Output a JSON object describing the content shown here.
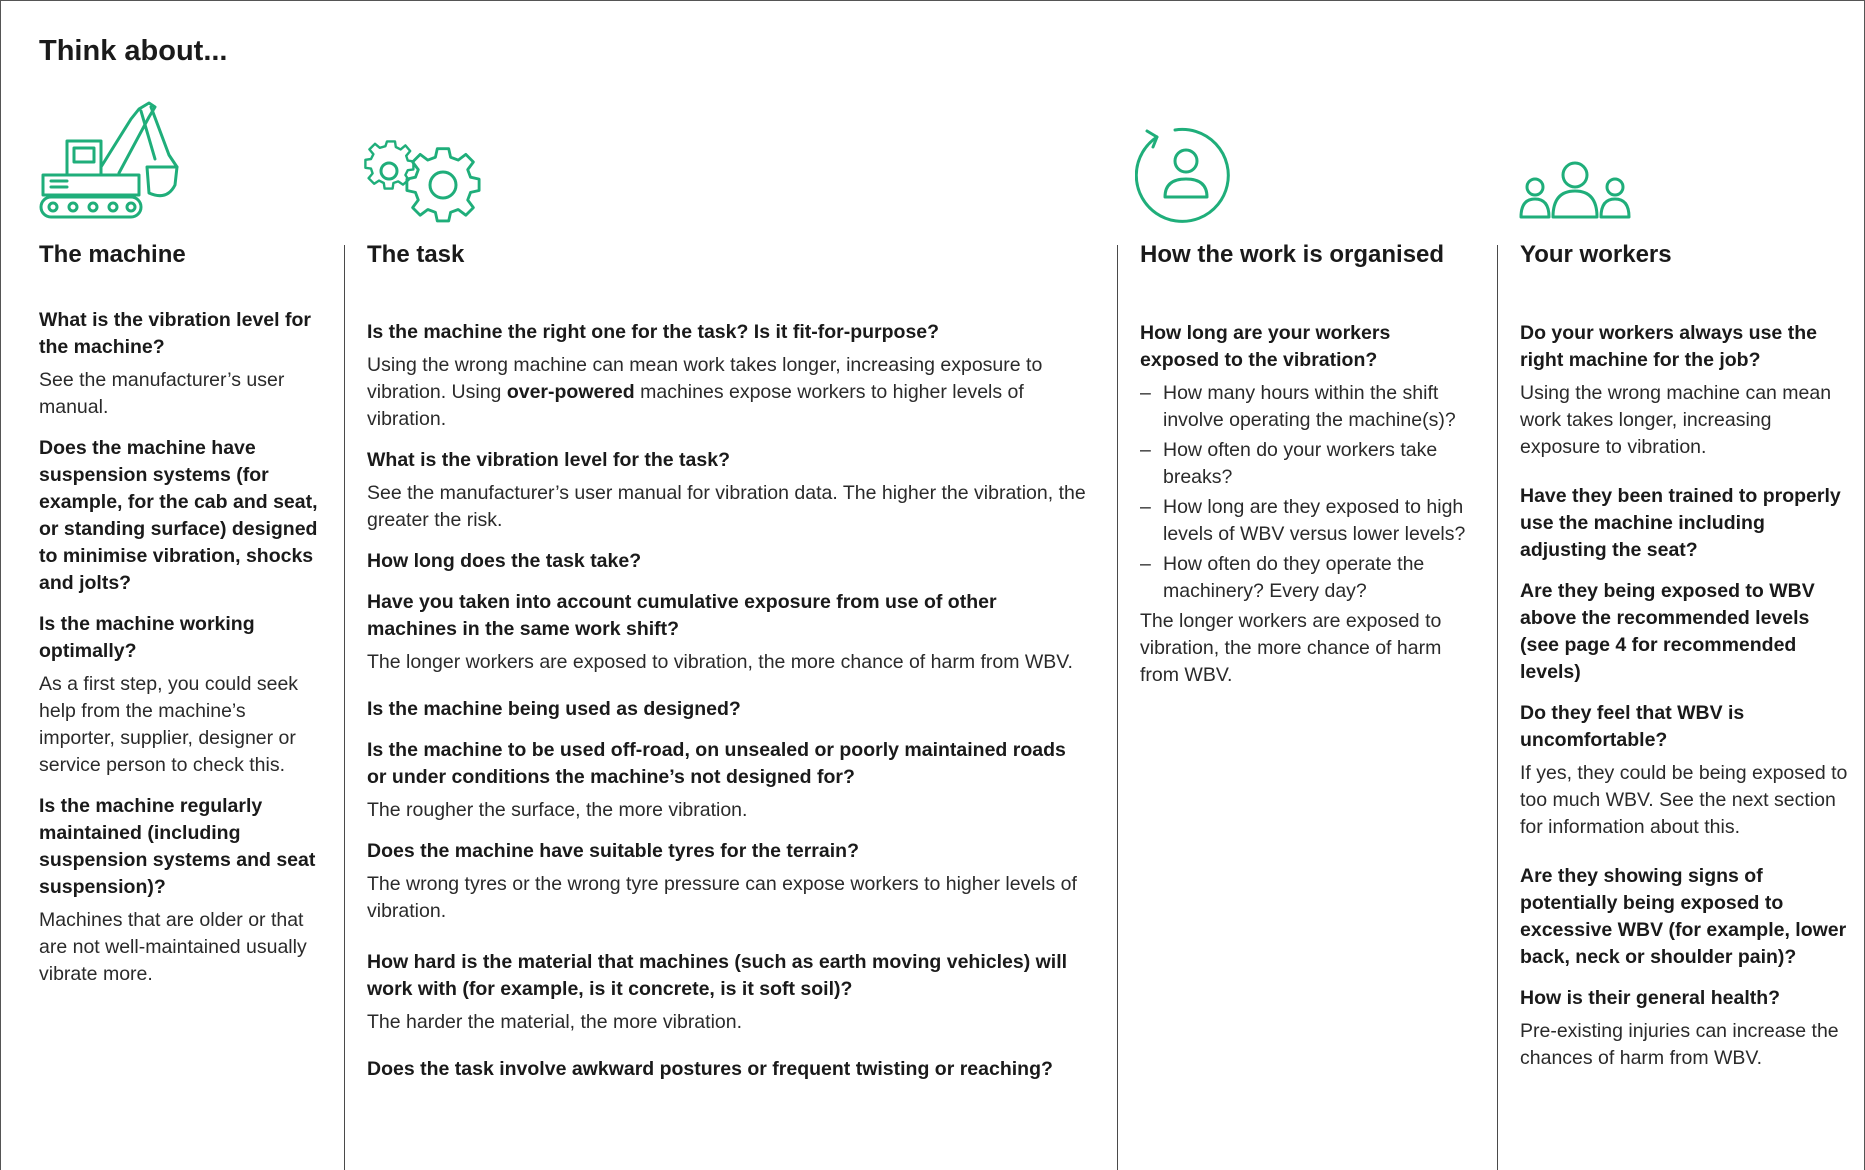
{
  "title": "Think about...",
  "accent_color": "#1fae7a",
  "icons": {
    "machine": "excavator-icon",
    "task": "gears-icon",
    "organised": "person-cycle-icon",
    "workers": "group-icon"
  },
  "machine": {
    "title": "The machine",
    "blocks": [
      {
        "q": "What is the vibration level for the machine?",
        "a": "See the manufacturer’s user manual."
      },
      {
        "q": "Does the machine have suspension systems (for example, for the cab and seat, or standing surface) designed to minimise vibration, shocks and jolts?"
      },
      {
        "q": "Is the machine working optimally?",
        "a": "As a first step, you could seek help from the machine’s importer, supplier, designer or service person to check this."
      },
      {
        "q": "Is the machine regularly maintained (including suspension systems and seat suspension)?",
        "a": "Machines that are older or that are not well-maintained usually vibrate more."
      }
    ]
  },
  "task": {
    "title": "The task",
    "b1_q": "Is the machine the right one for the task? Is it fit-for-purpose?",
    "b1_a_pre": "Using the wrong machine can mean work takes longer, increasing exposure to vibration. Using ",
    "b1_a_bold": "over-powered",
    "b1_a_post": " machines expose workers to higher levels of vibration.",
    "b2_q": "What is the vibration level for the task?",
    "b2_a": "See the manufacturer’s user manual for vibration data. The higher the vibration, the greater the risk.",
    "b3_q": "How long does the task take?",
    "b4_q": "Have you taken into account cumulative exposure from use of other machines in the same work shift?",
    "b4_a": "The longer workers are exposed to vibration, the more chance of harm from WBV.",
    "b5_q": "Is the machine being used as designed?",
    "b6_q": "Is the machine to be used off-road, on unsealed or poorly maintained roads or under conditions the machine’s not designed for?",
    "b6_a": "The rougher the surface, the more vibration.",
    "b7_q": "Does the machine have suitable tyres for the terrain?",
    "b7_a": "The wrong tyres or the wrong tyre pressure can expose workers to higher levels of vibration.",
    "b8_q": "How hard is the material that machines (such as earth moving vehicles) will work with (for example, is it concrete, is it soft soil)?",
    "b8_a": "The harder the material, the more vibration.",
    "b9_q": "Does the task involve awkward postures or frequent twisting or reaching?"
  },
  "organised": {
    "title": "How the work is organised",
    "q": "How long are your workers exposed to the vibration?",
    "items": [
      "How many hours within the shift involve operating the machine(s)?",
      "How often do your workers take breaks?",
      "How long are they exposed to high levels of WBV versus lower levels?",
      "How often do they operate the machinery? Every day?"
    ],
    "a": "The longer workers are exposed to vibration, the more chance of harm from WBV."
  },
  "workers": {
    "title": "Your workers",
    "b1_q": "Do your workers always use the right machine for the job?",
    "b1_a": "Using the wrong machine can mean work takes longer, increasing exposure to vibration.",
    "b2_q": "Have they been trained to properly use the machine including adjusting the seat?",
    "b3_q": "Are they being exposed to WBV above the recommended levels (see page 4 for recommended levels)",
    "b4_q": "Do they feel that WBV is uncomfortable?",
    "b4_a": "If yes, they could be being exposed to too much WBV. See the next section for information about this.",
    "b5_q": "Are they showing signs of potentially being exposed to excessive WBV (for example, lower back, neck or shoulder pain)?",
    "b6_q": "How is their general health?",
    "b6_a": "Pre-existing injuries can increase the chances of harm from WBV."
  }
}
